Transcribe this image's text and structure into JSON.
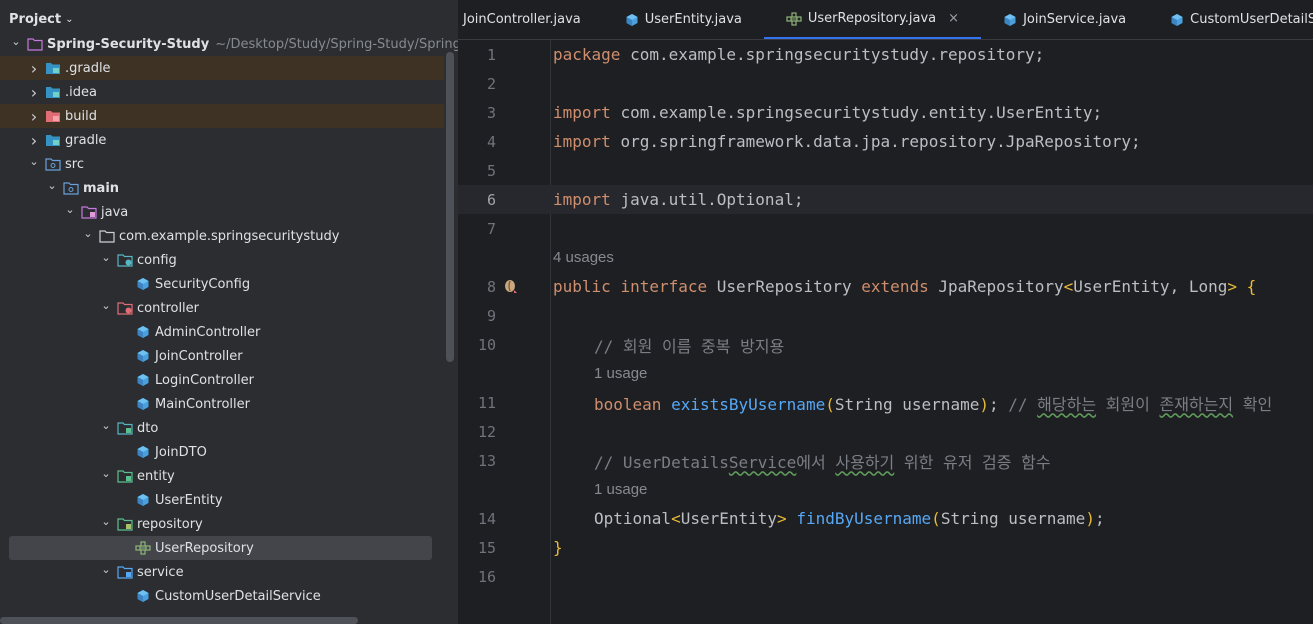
{
  "project_panel": {
    "title": "Project",
    "tree": [
      {
        "label": "Spring-Security-Study",
        "hint": "~/Desktop/Study/Spring-Study/Spring-S",
        "icon": "module-folder-icon",
        "depth": 0,
        "expanded": true,
        "bold": true
      },
      {
        "label": ".gradle",
        "icon": "folder-icon",
        "depth": 1,
        "expanded": false,
        "excluded": true
      },
      {
        "label": ".idea",
        "icon": "folder-icon",
        "depth": 1,
        "expanded": false
      },
      {
        "label": "build",
        "icon": "excluded-folder-icon",
        "depth": 1,
        "expanded": false,
        "excluded": true
      },
      {
        "label": "gradle",
        "icon": "folder-icon",
        "depth": 1,
        "expanded": false
      },
      {
        "label": "src",
        "icon": "source-folder-icon",
        "depth": 1,
        "expanded": true
      },
      {
        "label": "main",
        "icon": "source-folder-icon",
        "depth": 2,
        "expanded": true,
        "bold": true
      },
      {
        "label": "java",
        "icon": "java-root-icon",
        "depth": 3,
        "expanded": true
      },
      {
        "label": "com.example.springsecuritystudy",
        "icon": "package-icon",
        "depth": 4,
        "expanded": true
      },
      {
        "label": "config",
        "icon": "config-package-icon",
        "depth": 5,
        "expanded": true
      },
      {
        "label": "SecurityConfig",
        "icon": "class-icon",
        "depth": 6
      },
      {
        "label": "controller",
        "icon": "controller-package-icon",
        "depth": 5,
        "expanded": true
      },
      {
        "label": "AdminController",
        "icon": "class-icon",
        "depth": 6
      },
      {
        "label": "JoinController",
        "icon": "class-icon",
        "depth": 6
      },
      {
        "label": "LoginController",
        "icon": "class-icon",
        "depth": 6
      },
      {
        "label": "MainController",
        "icon": "class-icon",
        "depth": 6
      },
      {
        "label": "dto",
        "icon": "dto-package-icon",
        "depth": 5,
        "expanded": true
      },
      {
        "label": "JoinDTO",
        "icon": "class-icon",
        "depth": 6
      },
      {
        "label": "entity",
        "icon": "entity-package-icon",
        "depth": 5,
        "expanded": true
      },
      {
        "label": "UserEntity",
        "icon": "class-icon",
        "depth": 6
      },
      {
        "label": "repository",
        "icon": "repository-package-icon",
        "depth": 5,
        "expanded": true
      },
      {
        "label": "UserRepository",
        "icon": "repository-interface-icon",
        "depth": 6,
        "selected": true
      },
      {
        "label": "service",
        "icon": "service-package-icon",
        "depth": 5,
        "expanded": true
      },
      {
        "label": "CustomUserDetailService",
        "icon": "class-icon",
        "depth": 6
      }
    ]
  },
  "tabs": [
    {
      "label": "JoinController.java",
      "icon": "none"
    },
    {
      "label": "UserEntity.java",
      "icon": "class-icon"
    },
    {
      "label": "UserRepository.java",
      "icon": "repository-interface-icon",
      "active": true,
      "close": "×"
    },
    {
      "label": "JoinService.java",
      "icon": "class-icon"
    },
    {
      "label": "CustomUserDetailService.java",
      "icon": "class-icon"
    }
  ],
  "editor": {
    "current_line": 6,
    "rows": [
      {
        "kind": "line",
        "num": "1",
        "segments": [
          [
            "kw",
            "package"
          ],
          [
            "",
            "com.example.springsecuritystudy.repository;"
          ]
        ]
      },
      {
        "kind": "line",
        "num": "2",
        "segments": []
      },
      {
        "kind": "line",
        "num": "3",
        "segments": [
          [
            "kw",
            "import"
          ],
          [
            "",
            "com.example.springsecuritystudy.entity.UserEntity;"
          ]
        ]
      },
      {
        "kind": "line",
        "num": "4",
        "segments": [
          [
            "kw",
            "import"
          ],
          [
            "",
            "org.springframework.data.jpa.repository.JpaRepository;"
          ]
        ]
      },
      {
        "kind": "line",
        "num": "5",
        "segments": []
      },
      {
        "kind": "line",
        "num": "6",
        "segments": [
          [
            "kw",
            "import"
          ],
          [
            "",
            "java.util.Optional;"
          ]
        ]
      },
      {
        "kind": "line",
        "num": "7",
        "segments": []
      },
      {
        "kind": "usage",
        "indent": 0,
        "text": "4 usages"
      },
      {
        "kind": "line",
        "num": "8",
        "gutter_icon": "bean-icon",
        "segments": [
          [
            "kw",
            "public"
          ],
          [
            "kw",
            "interface"
          ],
          [
            "",
            "UserRepository"
          ],
          [
            "kw",
            "extends"
          ],
          [
            "",
            "JpaRepository"
          ],
          [
            "br",
            "<"
          ],
          [
            "",
            "UserEntity, Long"
          ],
          [
            "br",
            ">"
          ],
          [
            "br",
            "{"
          ]
        ]
      },
      {
        "kind": "line",
        "num": "9",
        "segments": []
      },
      {
        "kind": "line",
        "num": "10",
        "indent": 1,
        "segments": [
          [
            "cm",
            "// 회원 이름 중복 방지용"
          ]
        ]
      },
      {
        "kind": "usage",
        "indent": 1,
        "text": "1 usage"
      },
      {
        "kind": "line",
        "num": "11",
        "indent": 1,
        "segments": [
          [
            "kw",
            "boolean"
          ],
          [
            "fn",
            "existsByUsername"
          ],
          [
            "br",
            "("
          ],
          [
            "",
            "String username"
          ],
          [
            "br",
            ")"
          ],
          [
            "",
            "; "
          ],
          [
            "cm",
            "// "
          ],
          [
            "cm typo",
            "해당하는"
          ],
          [
            "cm",
            " 회원이 "
          ],
          [
            "cm typo",
            "존재하는지"
          ],
          [
            "cm",
            " 확인"
          ]
        ]
      },
      {
        "kind": "line",
        "num": "12",
        "segments": []
      },
      {
        "kind": "line",
        "num": "13",
        "indent": 1,
        "segments": [
          [
            "cm",
            "// UserDetails"
          ],
          [
            "cm typo",
            "Service"
          ],
          [
            "cm",
            "에서 "
          ],
          [
            "cm typo",
            "사용하기"
          ],
          [
            "cm",
            " 위한 유저 검증 함수"
          ]
        ]
      },
      {
        "kind": "usage",
        "indent": 1,
        "text": "1 usage"
      },
      {
        "kind": "line",
        "num": "14",
        "indent": 1,
        "segments": [
          [
            "",
            "Optional"
          ],
          [
            "br",
            "<"
          ],
          [
            "",
            "UserEntity"
          ],
          [
            "br",
            ">"
          ],
          [
            "fn",
            "findByUsername"
          ],
          [
            "br",
            "("
          ],
          [
            "",
            "String username"
          ],
          [
            "br",
            ")"
          ],
          [
            "",
            ";"
          ]
        ]
      },
      {
        "kind": "line",
        "num": "15",
        "segments": [
          [
            "br",
            "}"
          ]
        ]
      },
      {
        "kind": "line",
        "num": "16",
        "segments": []
      }
    ]
  },
  "colors": {
    "keyword": "#cf8e6d",
    "function": "#56a8f5",
    "comment": "#7a7e85",
    "bracket": "#e8ba36",
    "text": "#bcbec4",
    "accent": "#3574f0"
  }
}
